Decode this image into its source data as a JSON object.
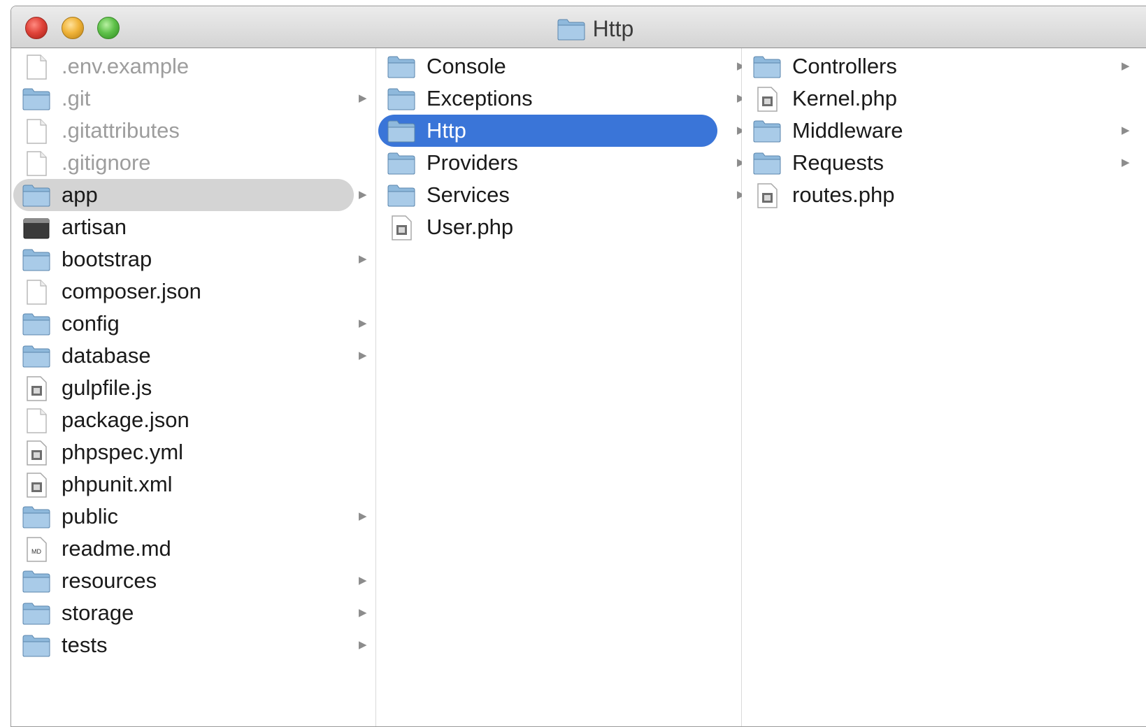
{
  "window": {
    "title": "Http"
  },
  "columns": [
    {
      "items": [
        {
          "name": ".env.example",
          "kind": "file-plain",
          "hidden": true,
          "has_children": false
        },
        {
          "name": ".git",
          "kind": "folder",
          "hidden": true,
          "has_children": true
        },
        {
          "name": ".gitattributes",
          "kind": "file-plain",
          "hidden": true,
          "has_children": false
        },
        {
          "name": ".gitignore",
          "kind": "file-plain",
          "hidden": true,
          "has_children": false
        },
        {
          "name": "app",
          "kind": "folder",
          "selected": "inactive",
          "has_children": true
        },
        {
          "name": "artisan",
          "kind": "file-exec",
          "has_children": false
        },
        {
          "name": "bootstrap",
          "kind": "folder",
          "has_children": true
        },
        {
          "name": "composer.json",
          "kind": "file-plain",
          "has_children": false
        },
        {
          "name": "config",
          "kind": "folder",
          "has_children": true
        },
        {
          "name": "database",
          "kind": "folder",
          "has_children": true
        },
        {
          "name": "gulpfile.js",
          "kind": "file-script",
          "has_children": false
        },
        {
          "name": "package.json",
          "kind": "file-plain",
          "has_children": false
        },
        {
          "name": "phpspec.yml",
          "kind": "file-script",
          "has_children": false
        },
        {
          "name": "phpunit.xml",
          "kind": "file-script",
          "has_children": false
        },
        {
          "name": "public",
          "kind": "folder",
          "has_children": true
        },
        {
          "name": "readme.md",
          "kind": "file-md",
          "has_children": false
        },
        {
          "name": "resources",
          "kind": "folder",
          "has_children": true
        },
        {
          "name": "storage",
          "kind": "folder",
          "has_children": true
        },
        {
          "name": "tests",
          "kind": "folder",
          "has_children": true
        }
      ]
    },
    {
      "items": [
        {
          "name": "Console",
          "kind": "folder",
          "has_children": true
        },
        {
          "name": "Exceptions",
          "kind": "folder",
          "has_children": true
        },
        {
          "name": "Http",
          "kind": "folder",
          "selected": "active",
          "has_children": true
        },
        {
          "name": "Providers",
          "kind": "folder",
          "has_children": true
        },
        {
          "name": "Services",
          "kind": "folder",
          "has_children": true
        },
        {
          "name": "User.php",
          "kind": "file-script",
          "has_children": false
        }
      ]
    },
    {
      "items": [
        {
          "name": "Controllers",
          "kind": "folder",
          "has_children": true
        },
        {
          "name": "Kernel.php",
          "kind": "file-script",
          "has_children": false
        },
        {
          "name": "Middleware",
          "kind": "folder",
          "has_children": true
        },
        {
          "name": "Requests",
          "kind": "folder",
          "has_children": true
        },
        {
          "name": "routes.php",
          "kind": "file-script",
          "has_children": false
        }
      ]
    }
  ],
  "icons": {
    "folder": "folder-icon",
    "file-plain": "document-icon",
    "file-exec": "terminal-icon",
    "file-script": "script-icon",
    "file-md": "markdown-icon"
  },
  "md_badge": "MD",
  "colors": {
    "selection_active": "#3a75d8",
    "selection_inactive": "#d4d4d4",
    "hidden_text": "#9d9d9d"
  }
}
